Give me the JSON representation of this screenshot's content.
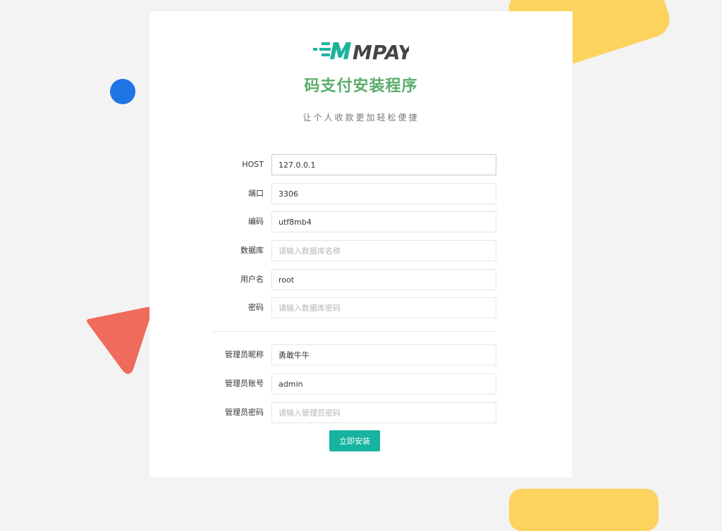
{
  "brand": {
    "logo_text": "MPAY",
    "accent": "#16b39e",
    "title_color": "#5aad6b"
  },
  "page": {
    "title": "码支付安装程序",
    "subtitle": "让个人收款更加轻松便捷"
  },
  "db_fields": [
    {
      "label": "HOST",
      "value": "127.0.0.1",
      "placeholder": ""
    },
    {
      "label": "端口",
      "value": "3306",
      "placeholder": ""
    },
    {
      "label": "编码",
      "value": "utf8mb4",
      "placeholder": ""
    },
    {
      "label": "数据库",
      "value": "",
      "placeholder": "请输入数据库名称"
    },
    {
      "label": "用户名",
      "value": "root",
      "placeholder": ""
    },
    {
      "label": "密码",
      "value": "",
      "placeholder": "请输入数据库密码"
    }
  ],
  "admin_fields": [
    {
      "label": "管理员昵称",
      "value": "勇敢牛牛",
      "placeholder": ""
    },
    {
      "label": "管理员账号",
      "value": "admin",
      "placeholder": ""
    },
    {
      "label": "管理员密码",
      "value": "",
      "placeholder": "请输入管理员密码"
    }
  ],
  "submit_label": "立即安装"
}
